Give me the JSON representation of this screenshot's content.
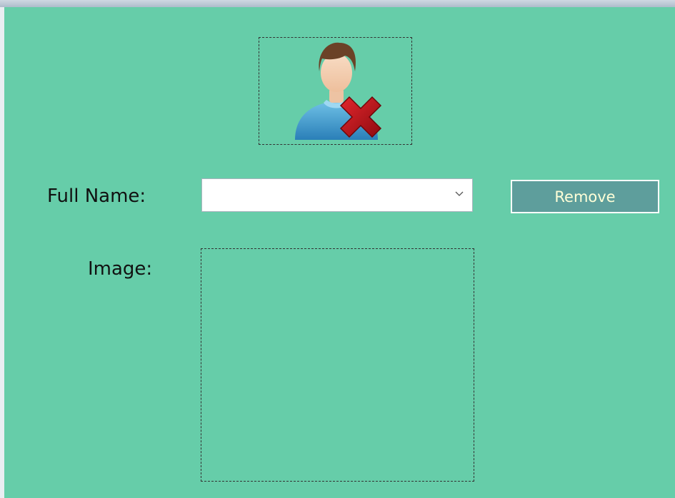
{
  "form": {
    "header_icon": "remove-user-icon",
    "full_name_label": "Full Name:",
    "full_name_value": "",
    "full_name_dropdown_icon": "chevron-down-icon",
    "remove_button_label": "Remove",
    "image_label": "Image:"
  },
  "colors": {
    "background": "#66cda9",
    "button_background": "#5e9e9c",
    "button_text": "#ffffd8",
    "remove_x": "#c0141a"
  }
}
